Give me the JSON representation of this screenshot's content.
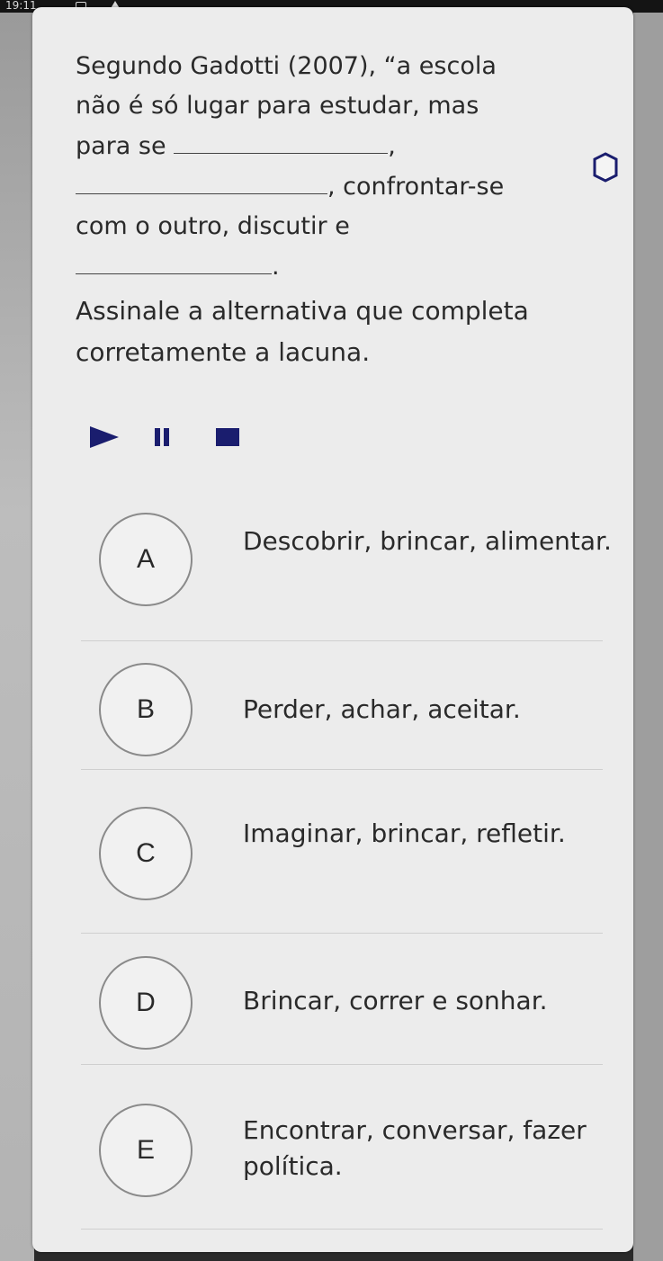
{
  "status_bar": {
    "time": "19:11"
  },
  "question": {
    "line1": "Segundo Gadotti (2007), “a escola",
    "line2": "não é só lugar para estudar, mas",
    "line3_prefix": "para se",
    "line3_suffix": ",",
    "line4_suffix": ", confrontar-se",
    "line5": "com o outro, discutir e",
    "line6_suffix": "."
  },
  "instruction": "Assinale a alternativa que completa corretamente a lacuna.",
  "options": [
    {
      "letter": "A",
      "text": "Descobrir, brincar, alimentar."
    },
    {
      "letter": "B",
      "text": "Perder, achar, aceitar."
    },
    {
      "letter": "C",
      "text": "Imaginar, brincar, refletir."
    },
    {
      "letter": "D",
      "text": "Brincar, correr e sonhar."
    },
    {
      "letter": "E",
      "text": "Encontrar, conversar, fazer política."
    }
  ],
  "colors": {
    "media_controls": "#1a1d6e",
    "card_background": "#ececec"
  },
  "icons": [
    "settings-icon",
    "play-icon",
    "pause-icon",
    "stop-icon"
  ]
}
